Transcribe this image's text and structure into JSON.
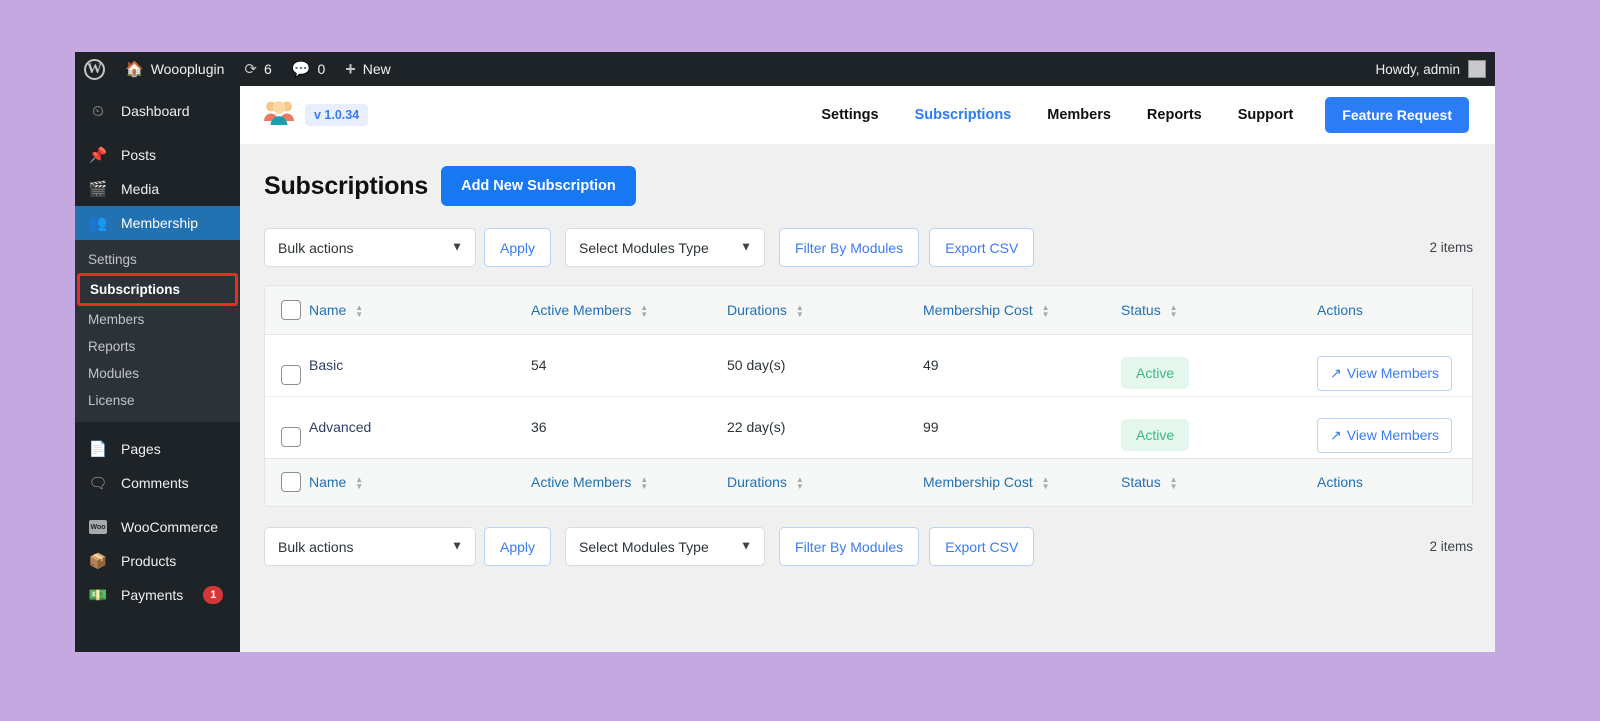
{
  "adminbar": {
    "wp_logo": "wordpress-logo",
    "site_name": "Wooplugin",
    "site_name_display": "Woooplugin",
    "updates_count": "6",
    "comments_count": "0",
    "new_label": "New",
    "howdy": "Howdy, admin"
  },
  "sidebar": {
    "items": [
      {
        "label": "Dashboard",
        "icon": "dashboard-icon"
      },
      {
        "label": "Posts",
        "icon": "pin-icon"
      },
      {
        "label": "Media",
        "icon": "media-icon"
      },
      {
        "label": "Membership",
        "icon": "users-icon",
        "current": true
      },
      {
        "label": "Pages",
        "icon": "pages-icon"
      },
      {
        "label": "Comments",
        "icon": "comment-icon"
      },
      {
        "label": "WooCommerce",
        "icon": "woo-icon"
      },
      {
        "label": "Products",
        "icon": "products-icon"
      },
      {
        "label": "Payments",
        "icon": "payments-icon",
        "badge": "1"
      }
    ],
    "submenu": [
      {
        "label": "Settings"
      },
      {
        "label": "Subscriptions",
        "active": true,
        "highlighted": true
      },
      {
        "label": "Members"
      },
      {
        "label": "Reports"
      },
      {
        "label": "Modules"
      },
      {
        "label": "License"
      }
    ]
  },
  "plugin_header": {
    "logo_icon": "membership-people-logo",
    "version": "v 1.0.34",
    "nav": [
      {
        "label": "Settings",
        "active": false
      },
      {
        "label": "Subscriptions",
        "active": true
      },
      {
        "label": "Members",
        "active": false
      },
      {
        "label": "Reports",
        "active": false
      },
      {
        "label": "Support",
        "active": false
      }
    ],
    "feature_request": "Feature Request"
  },
  "page": {
    "title": "Subscriptions",
    "add_button": "Add New Subscription"
  },
  "toolbar": {
    "bulk_actions_value": "Bulk actions",
    "apply_label": "Apply",
    "modules_value": "Select Modules Type",
    "filter_label": "Filter By Modules",
    "export_label": "Export CSV",
    "items_count": "2 items"
  },
  "table": {
    "columns": [
      {
        "label": "Name",
        "sortable": true
      },
      {
        "label": "Active Members",
        "sortable": true
      },
      {
        "label": "Durations",
        "sortable": true
      },
      {
        "label": "Membership Cost",
        "sortable": true
      },
      {
        "label": "Status",
        "sortable": true
      },
      {
        "label": "Actions",
        "sortable": false
      }
    ],
    "rows": [
      {
        "name": "Basic",
        "active_members": "54",
        "duration": "50 day(s)",
        "cost": "49",
        "status": "Active",
        "action_label": "View Members",
        "action_icon": "arrow-up-right-icon"
      },
      {
        "name": "Advanced",
        "active_members": "36",
        "duration": "22 day(s)",
        "cost": "99",
        "status": "Active",
        "action_label": "View Members",
        "action_icon": "arrow-up-right-icon"
      }
    ]
  },
  "colors": {
    "accent_blue": "#2b7cf5",
    "link_blue": "#3a7bf0",
    "status_green_text": "#3cb98a",
    "status_green_bg": "#e5f6ec",
    "admin_dark": "#1d2327",
    "highlight_red": "#ee2b22",
    "page_bg": "#c4a9e0"
  }
}
